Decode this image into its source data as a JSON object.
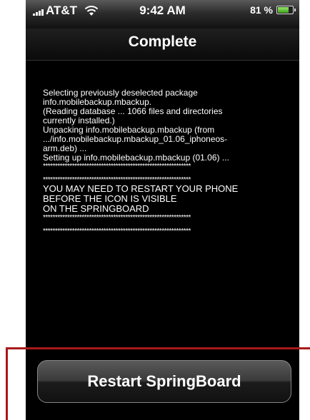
{
  "status_bar": {
    "carrier": "AT&T",
    "time": "9:42 AM",
    "battery_percent": "81 %",
    "battery_level": 0.81,
    "wifi_icon": "wifi-icon",
    "signal_icon": "signal-bars-icon"
  },
  "title": "Complete",
  "log_lines": [
    "Selecting previously deselected package",
    "info.mobilebackup.mbackup.",
    "(Reading database ... 1066 files and directories",
    "currently installed.)",
    "Unpacking info.mobilebackup.mbackup (from",
    ".../info.mobilebackup.mbackup_01.06_iphoneos-",
    "arm.deb) ...",
    "Setting up info.mobilebackup.mbackup (01.06) ..."
  ],
  "separator": "*************************************************************",
  "warning_lines": [
    "YOU MAY NEED TO RESTART YOUR PHONE",
    "BEFORE THE ICON IS VISIBLE",
    "ON THE SPRINGBOARD"
  ],
  "restart_button_label": "Restart SpringBoard",
  "colors": {
    "annotation": "#a81919",
    "background": "#000000",
    "text": "#ffffff"
  }
}
